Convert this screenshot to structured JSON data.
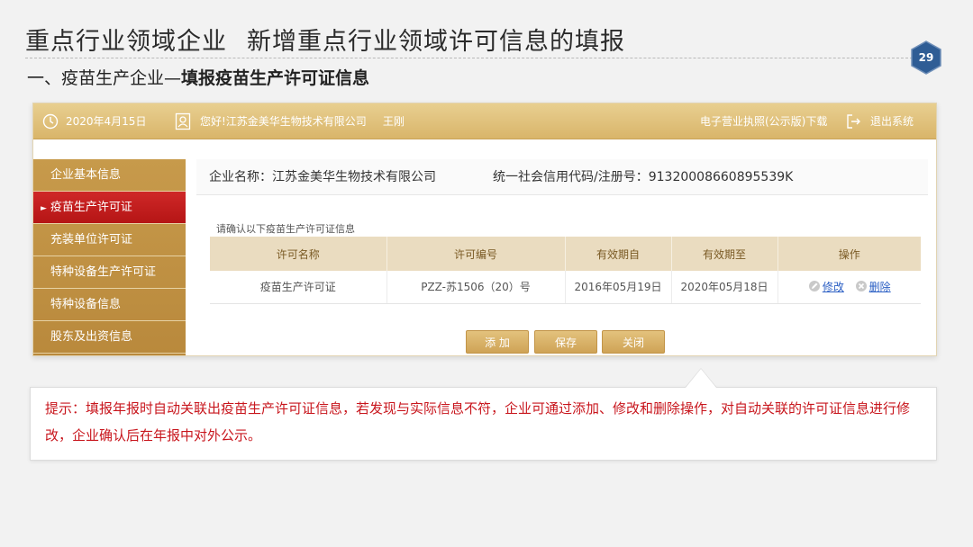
{
  "slide": {
    "title_part1": "重点行业领域企业",
    "title_part2": "新增重点行业领域许可信息的填报",
    "page_number": "29",
    "section_prefix": "一、疫苗生产企业—",
    "section_bold": "填报疫苗生产许可证信息"
  },
  "topbar": {
    "date": "2020年4月15日",
    "greeting": "您好!江苏金美华生物技术有限公司",
    "user": "王刚",
    "license_download": "电子营业执照(公示版)下载",
    "logout": "退出系统"
  },
  "sidebar": {
    "items": [
      {
        "label": "企业基本信息"
      },
      {
        "label": "疫苗生产许可证"
      },
      {
        "label": "充装单位许可证"
      },
      {
        "label": "特种设备生产许可证"
      },
      {
        "label": "特种设备信息"
      },
      {
        "label": "股东及出资信息"
      }
    ],
    "active_index": 1
  },
  "company": {
    "name": "企业名称：江苏金美华生物技术有限公司",
    "code": "统一社会信用代码/注册号：91320008660895539K"
  },
  "license_table": {
    "caption": "请确认以下疫苗生产许可证信息",
    "columns": [
      "许可名称",
      "许可编号",
      "有效期自",
      "有效期至",
      "操作"
    ],
    "rows": [
      {
        "name": "疫苗生产许可证",
        "number": "PZZ-苏1506（20）号",
        "valid_from": "2016年05月19日",
        "valid_to": "2020年05月18日",
        "edit": "修改",
        "delete": "删除"
      }
    ]
  },
  "buttons": {
    "add": "添 加",
    "save": "保存",
    "close": "关闭"
  },
  "tip": {
    "text": "提示：填报年报时自动关联出疫苗生产许可证信息，若发现与实际信息不符，企业可通过添加、修改和删除操作，对自动关联的许可证信息进行修改，企业确认后在年报中对外公示。"
  },
  "colors": {
    "gold": "#d9b56a",
    "active_red": "#c41e1e",
    "tip_red": "#c8161d",
    "badge_blue": "#2f5d95"
  }
}
